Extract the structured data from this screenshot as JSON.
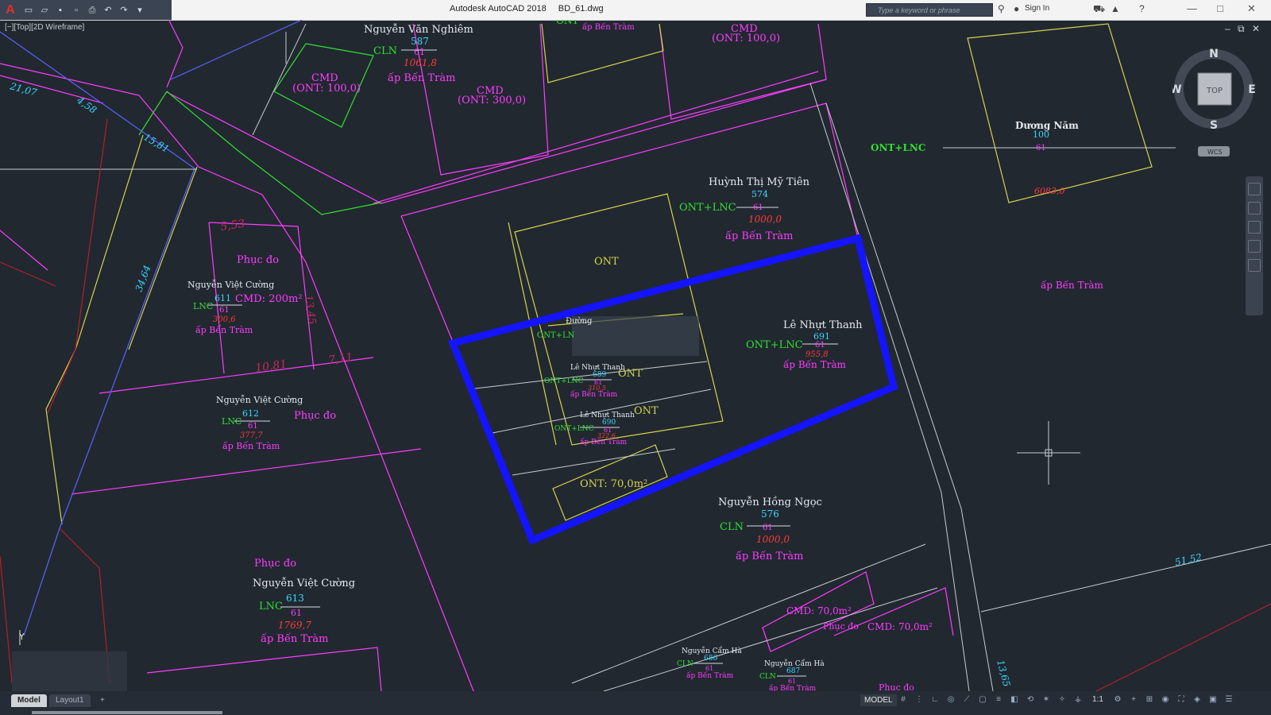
{
  "window": {
    "app_title": "Autodesk AutoCAD 2018",
    "file_name": "BD_61.dwg",
    "search_placeholder": "Type a keyword or phrase",
    "sign_in": "Sign In"
  },
  "viewport": {
    "label": "[−][Top][2D Wireframe]",
    "viewcube": {
      "north": "N",
      "south": "S",
      "east": "E",
      "west": "W",
      "top": "TOP",
      "wcs": "WCS"
    },
    "ucs_y": "Y"
  },
  "status": {
    "tab_model": "Model",
    "tab_layout": "Layout1",
    "tab_add": "+",
    "model_button": "MODEL",
    "scale": "1:1"
  },
  "colors": {
    "background": "#212830",
    "highlight_blue": "#1414ff",
    "magenta": "#ff3cff",
    "yellow": "#d4d44a",
    "green": "#2fe02f",
    "cyan": "#3ad8ff",
    "red_label": "#ff3a3a"
  },
  "drawing": {
    "dimensions": [
      "21,07",
      "4,58",
      "15,81",
      "34,64",
      "5,53",
      "13,45",
      "10,81",
      "7,11",
      "51,52",
      "13,65"
    ],
    "parcels": [
      {
        "owner": "Nguyễn Văn Nghiêm",
        "code": "CLN",
        "parcel": "587",
        "sheet": "61",
        "area": "1061,8",
        "place": "ấp Bến Tràm"
      },
      {
        "owner": "Huỳnh Thị Mỹ Tiên",
        "code": "ONT+LNC",
        "parcel": "574",
        "sheet": "61",
        "area": "1000,0",
        "place": "ấp Bến Tràm"
      },
      {
        "owner": "Dương Năm",
        "code": "ONT+LNC",
        "parcel": "100",
        "sheet": "61",
        "area": "6083,0"
      },
      {
        "owner": "Nguyễn Việt Cường",
        "code": "LNC",
        "parcel": "611",
        "sheet": "61",
        "area": "300,6",
        "place": "ấp Bến Tràm",
        "note": "CMD: 200m²"
      },
      {
        "owner": "Nguyễn Việt Cường",
        "code": "LNC",
        "parcel": "612",
        "sheet": "61",
        "area": "377,7",
        "place": "ấp Bến Tràm"
      },
      {
        "owner": "Lê Nhựt Thanh",
        "code": "ONT+LNC",
        "parcel": "691",
        "sheet": "61",
        "area": "955,8",
        "place": "ấp Bến Tràm"
      },
      {
        "owner": "Lê Nhựt Thanh",
        "code": "ONT+LNC",
        "parcel": "689",
        "sheet": "61",
        "area": "310,5",
        "place": "ấp Bến Tràm"
      },
      {
        "owner": "Lê Nhựt Thanh",
        "code": "ONT+LNC",
        "parcel": "690",
        "sheet": "61",
        "area": "322,6",
        "place": "ấp Bến Tràm"
      },
      {
        "owner": "Nguyễn Hồng Ngọc",
        "code": "CLN",
        "parcel": "576",
        "sheet": "61",
        "area": "1000,0",
        "place": "ấp Bến Tràm"
      },
      {
        "owner": "Nguyễn Việt Cường",
        "code": "LNC",
        "parcel": "613",
        "sheet": "61",
        "area": "1769,7",
        "place": "ấp Bến Tràm"
      },
      {
        "owner": "Nguyễn Cẩm Hà",
        "code": "CLN",
        "parcel": "686",
        "sheet": "61",
        "area": "",
        "place": "ấp Bến Tràm"
      },
      {
        "owner": "Nguyễn Cẩm Hà",
        "code": "CLN",
        "parcel": "687",
        "sheet": "61",
        "area": "",
        "place": "ấp Bến Tràm"
      }
    ],
    "labels": {
      "cmd1": "CMD",
      "cmd1b": "(ONT: 100,0)",
      "cmd2": "CMD",
      "cmd2b": "(ONT: 300,0)",
      "cmd3": "CMD",
      "cmd3b": "(ONT: 100,0)",
      "ont_top": "ONT",
      "ap_top": "ấp Bến Tràm",
      "ont_a": "ONT",
      "ont_b": "ONT",
      "ont_c": "ONT",
      "ont_area": "ONT: 70,0m²",
      "cmd70a": "CMD: 70,0m²",
      "cmd70b": "CMD: 70,0m²",
      "phuc_do1": "Phục đo",
      "phuc_do2": "Phục đo",
      "phuc_do3": "Phục đo",
      "phuc_do4": "Phục đo",
      "phuc_do5": "Phục đo",
      "ap_right": "ấp Bến Tràm",
      "ontlnc_small": "ONT+LN",
      "road": "Đường"
    }
  }
}
